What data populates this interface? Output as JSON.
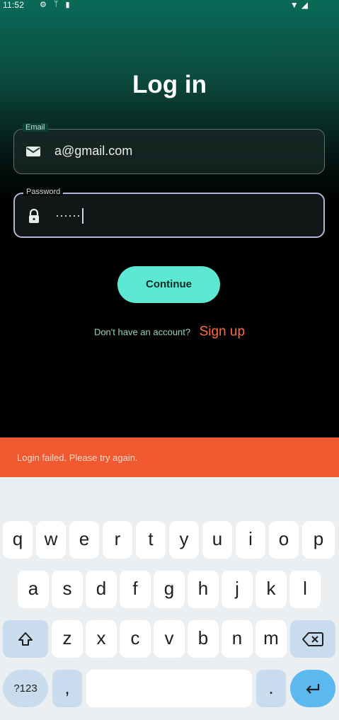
{
  "status_bar": {
    "time": "11:52",
    "left_icons": [
      "settings-icon",
      "usb-icon",
      "battery-icon"
    ],
    "right_icons": [
      "wifi-icon",
      "signal-icon"
    ]
  },
  "screen": {
    "title": "Log in",
    "email": {
      "label": "Email",
      "value": "a@gmail.com",
      "icon": "mail-icon"
    },
    "password": {
      "label": "Password",
      "value": "······",
      "icon": "lock-icon",
      "focused": true
    },
    "continue_label": "Continue",
    "signup_prompt": "Don't have an account?",
    "signup_link": "Sign up"
  },
  "snackbar": {
    "message": "Login failed. Please try again."
  },
  "keyboard": {
    "row1": [
      "q",
      "w",
      "e",
      "r",
      "t",
      "y",
      "u",
      "i",
      "o",
      "p"
    ],
    "row2": [
      "a",
      "s",
      "d",
      "f",
      "g",
      "h",
      "j",
      "k",
      "l"
    ],
    "row3": [
      "z",
      "x",
      "c",
      "v",
      "b",
      "n",
      "m"
    ],
    "symbols_label": "?123",
    "comma_label": ",",
    "period_label": "."
  },
  "colors": {
    "accent": "#5ce8d2",
    "signup_link": "#ff6a3c",
    "snackbar": "#f15a30",
    "enter_key": "#5cb9f0"
  }
}
